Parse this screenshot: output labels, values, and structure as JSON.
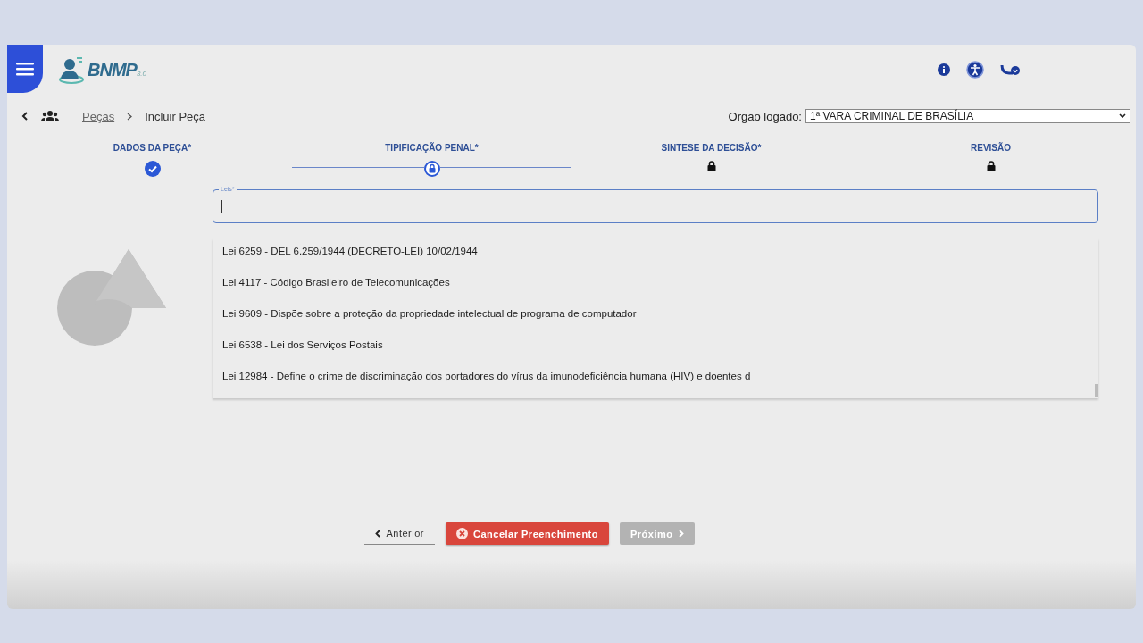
{
  "header": {
    "logo": {
      "name": "BNMP",
      "version": "3.0"
    }
  },
  "breadcrumb": {
    "link": "Peças",
    "current": "Incluir Peça"
  },
  "orgao": {
    "label": "Orgão logado:",
    "value": "1ª VARA CRIMINAL DE BRASÍLIA"
  },
  "steps": [
    {
      "label": "DADOS DA PEÇA*",
      "kind": "done",
      "selected": false
    },
    {
      "label": "TIPIFICAÇÃO PENAL*",
      "kind": "current",
      "selected": true
    },
    {
      "label": "SINTESE DA DECISÃO*",
      "kind": "locked",
      "selected": false
    },
    {
      "label": "REVISÃO",
      "kind": "locked",
      "selected": false
    }
  ],
  "field": {
    "label": "Leis*"
  },
  "options": [
    "Lei 6259 - DEL 6.259/1944 (DECRETO-LEI) 10/02/1944",
    "Lei 4117 - Código Brasileiro de Telecomunicações",
    "Lei 9609 - Dispõe sobre a proteção da propriedade intelectual de programa de computador",
    "Lei 6538 - Lei dos Serviços Postais",
    "Lei 12984 - Define o crime de discriminação dos portadores do vírus da imunodeficiência humana (HIV) e doentes d"
  ],
  "buttons": [
    {
      "label": "Anterior",
      "kind": "back",
      "disabled": false
    },
    {
      "label": "Cancelar Preenchimento",
      "kind": "cancel",
      "disabled": false
    },
    {
      "label": "Próximo",
      "kind": "next",
      "disabled": true
    }
  ]
}
